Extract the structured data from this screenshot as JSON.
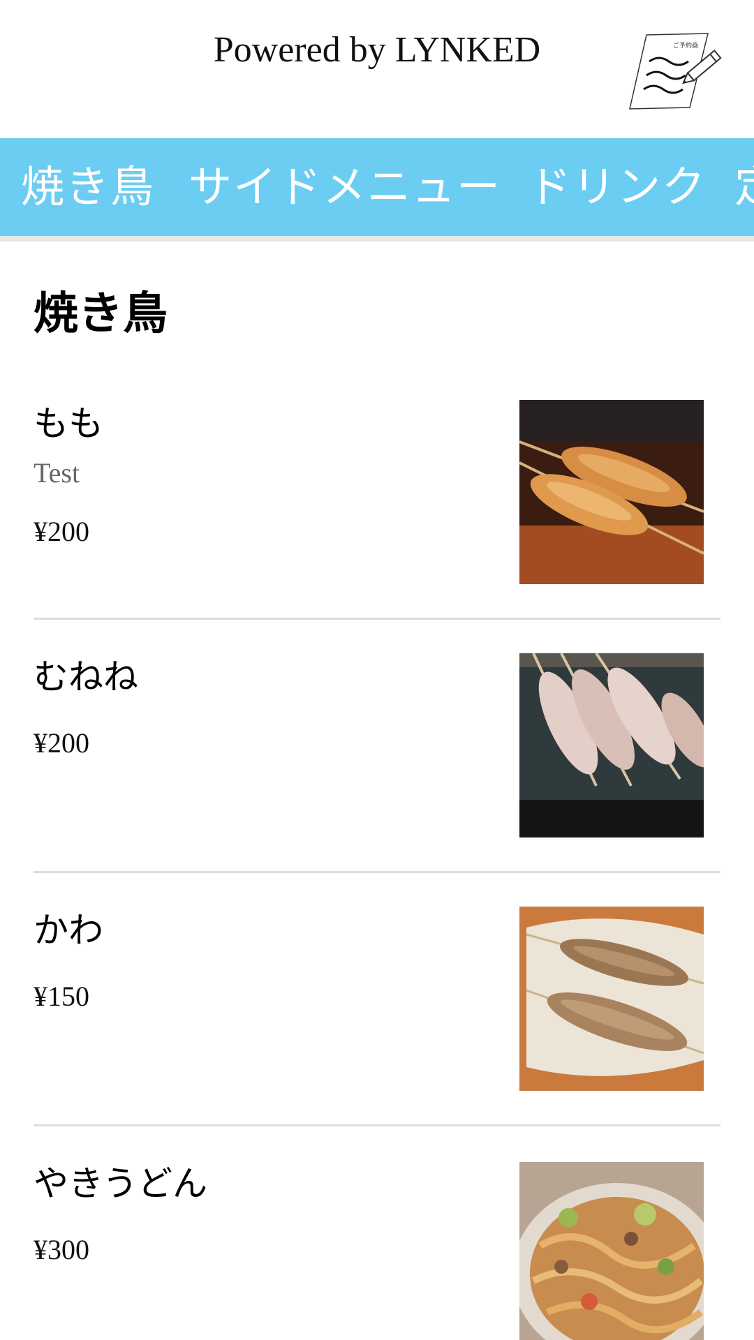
{
  "header": {
    "powered_by": "Powered by LYNKED",
    "reserve_label": "ご予約画"
  },
  "categories": [
    "焼き鳥",
    "サイドメニュー",
    "ドリンク",
    "定"
  ],
  "section": {
    "title": "焼き鳥"
  },
  "items": [
    {
      "name": "もも",
      "description": "Test",
      "price": "¥200",
      "image": "momo-skewer-photo"
    },
    {
      "name": "むねね",
      "price": "¥200",
      "image": "mune-skewer-photo"
    },
    {
      "name": "かわ",
      "price": "¥150",
      "image": "kawa-skewer-photo"
    },
    {
      "name": "やきうどん",
      "price": "¥300",
      "image": "yaki-udon-photo"
    }
  ],
  "colors": {
    "accent": "#6ccdf3",
    "divider": "#dcdcdc"
  }
}
